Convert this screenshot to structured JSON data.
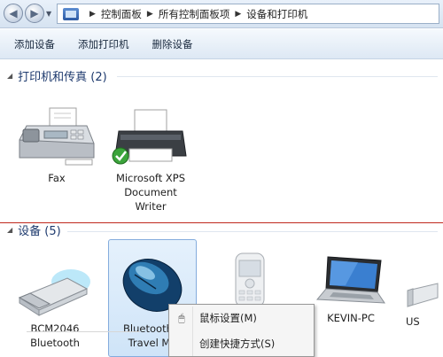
{
  "address_bar": {
    "breadcrumbs": [
      "控制面板",
      "所有控制面板项",
      "设备和打印机"
    ]
  },
  "toolbar": {
    "buttons": [
      "添加设备",
      "添加打印机",
      "删除设备"
    ]
  },
  "groups": {
    "printers": {
      "title": "打印机和传真 (2)",
      "items": [
        {
          "label": "Fax",
          "icon": "fax-machine-icon"
        },
        {
          "label_lines": [
            "Microsoft XPS",
            "Document",
            "Writer"
          ],
          "icon": "printer-icon",
          "default": true
        }
      ]
    },
    "devices": {
      "title": "设备 (5)",
      "items": [
        {
          "label_lines": [
            "BCM2046",
            "Bluetooth"
          ],
          "icon": "usb-bluetooth-dongle-icon"
        },
        {
          "label_lines": [
            "Bluetooth L",
            "Travel Mo"
          ],
          "icon": "mouse-icon",
          "selected": true
        },
        {
          "label": "",
          "icon": "mobile-phone-icon"
        },
        {
          "label": "KEVIN-PC",
          "icon": "laptop-icon"
        },
        {
          "label": "US",
          "icon": "usb-device-icon"
        }
      ]
    }
  },
  "context_menu": {
    "items": [
      {
        "label": "鼠标设置(M)",
        "icon": "mouse-settings-icon"
      },
      {
        "label": "创建快捷方式(S)"
      }
    ]
  },
  "colors": {
    "selection_bg": "#cfe4f8",
    "selection_border": "#84acdd",
    "group_title": "#1e3a6e",
    "annotation_line": "#c0281d"
  }
}
